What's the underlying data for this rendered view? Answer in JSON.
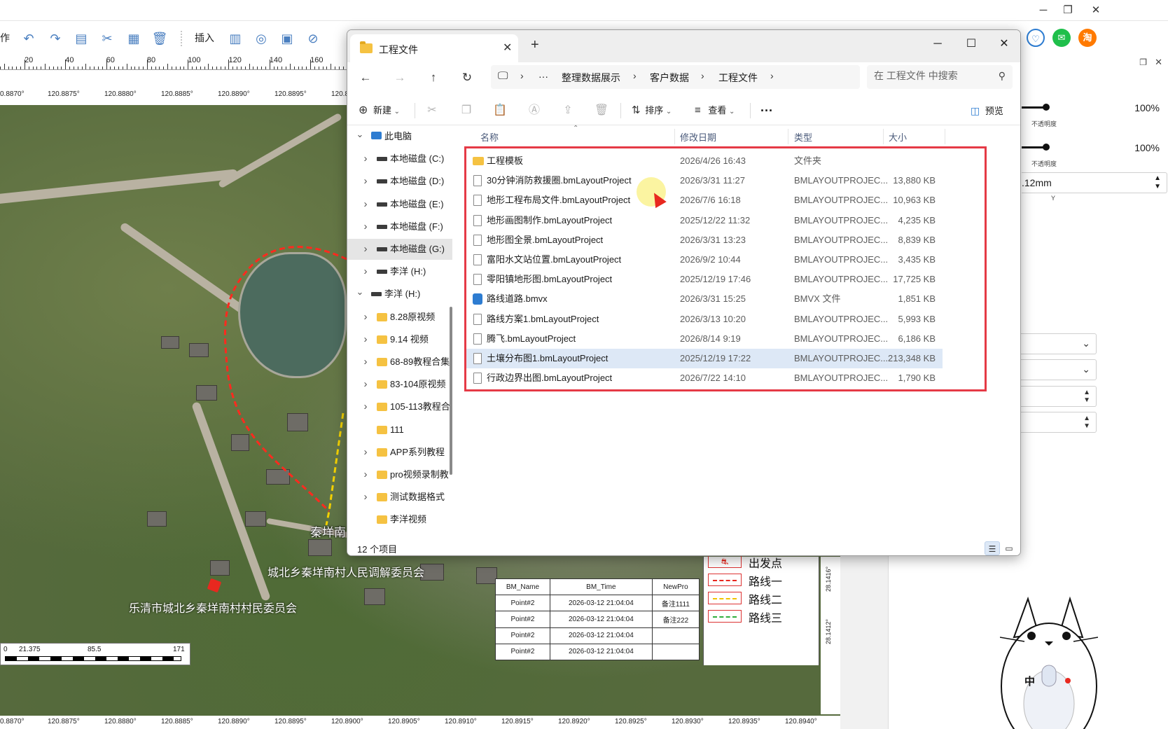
{
  "app": {
    "toolbar": {
      "insert_label": "插入",
      "left_cut_text": "作"
    },
    "ruler": [
      "20",
      "40",
      "60",
      "80",
      "100",
      "120",
      "140",
      "160"
    ],
    "coords_top": [
      "0.8870°",
      "120.8875°",
      "120.8880°",
      "120.8885°",
      "120.8890°",
      "120.8895°",
      "120.8"
    ],
    "coords_bottom": [
      "0.8870°",
      "120.8875°",
      "120.8880°",
      "120.8885°",
      "120.8890°",
      "120.8895°",
      "120.8900°",
      "120.8905°",
      "120.8910°",
      "120.8915°",
      "120.8920°",
      "120.8925°",
      "120.8930°",
      "120.8935°",
      "120.8940°"
    ],
    "map_labels": {
      "village_short": "秦垟南",
      "committee_mediation": "城北乡秦垟南村人民调解委员会",
      "committee_villagers": "乐清市城北乡秦垟南村村民委员会"
    },
    "scalebar": [
      "0",
      "21.375",
      "85.5",
      "171"
    ],
    "attr_table": {
      "headers": [
        "BM_Name",
        "BM_Time",
        "NewPro"
      ],
      "rows": [
        [
          "Point#2",
          "2026-03-12 21:04:04",
          "备注1111"
        ],
        [
          "Point#2",
          "2026-03-12 21:04:04",
          "备注222"
        ],
        [
          "Point#2",
          "2026-03-12 21:04:04",
          ""
        ],
        [
          "Point#2",
          "2026-03-12 21:04:04",
          ""
        ]
      ]
    },
    "legend": [
      {
        "label": "出发点",
        "color": "#e8281f"
      },
      {
        "label": "路线一",
        "color": "#e8281f"
      },
      {
        "label": "路线二",
        "color": "#f2c300"
      },
      {
        "label": "路线三",
        "color": "#2fae3c"
      }
    ],
    "lat_labels": [
      "28.1416°",
      "28.1412°"
    ],
    "right_panel": {
      "opacity1_value": "100%",
      "opacity1_label": "不透明度",
      "opacity2_value": "100%",
      "opacity2_label": "不透明度",
      "size_value": ".12mm",
      "size_axis": "Y"
    },
    "ext_icons": {
      "taobao": "淘"
    },
    "mascot": {
      "ime_label": "中"
    }
  },
  "explorer": {
    "tab_title": "工程文件",
    "breadcrumbs": [
      "整理数据展示",
      "客户数据",
      "工程文件"
    ],
    "search_placeholder": "在 工程文件 中搜索",
    "commands": {
      "new": "新建",
      "sort": "排序",
      "view": "查看",
      "preview": "预览"
    },
    "nav": [
      {
        "label": "此电脑",
        "type": "pc",
        "level": 0,
        "expanded": true
      },
      {
        "label": "本地磁盘 (C:)",
        "type": "drive",
        "level": 1
      },
      {
        "label": "本地磁盘 (D:)",
        "type": "drive",
        "level": 1
      },
      {
        "label": "本地磁盘 (E:)",
        "type": "drive",
        "level": 1
      },
      {
        "label": "本地磁盘 (F:)",
        "type": "drive",
        "level": 1
      },
      {
        "label": "本地磁盘 (G:)",
        "type": "drive",
        "level": 1,
        "selected": true
      },
      {
        "label": "李洋 (H:)",
        "type": "drive",
        "level": 1
      },
      {
        "label": "李洋 (H:)",
        "type": "drive",
        "level": 0,
        "expanded": true
      },
      {
        "label": "8.28原视频",
        "type": "folder",
        "level": 1
      },
      {
        "label": "9.14 视频",
        "type": "folder",
        "level": 1
      },
      {
        "label": "68-89教程合集",
        "type": "folder",
        "level": 1
      },
      {
        "label": "83-104原视频",
        "type": "folder",
        "level": 1
      },
      {
        "label": "105-113教程合",
        "type": "folder",
        "level": 1
      },
      {
        "label": "111",
        "type": "folder",
        "level": 1,
        "nochev": true
      },
      {
        "label": "APP系列教程",
        "type": "folder",
        "level": 1
      },
      {
        "label": "pro视频录制教",
        "type": "folder",
        "level": 1
      },
      {
        "label": "测试数据格式",
        "type": "folder",
        "level": 1
      },
      {
        "label": "李洋视频",
        "type": "folder",
        "level": 1,
        "nochev": true
      }
    ],
    "columns": {
      "name": "名称",
      "date": "修改日期",
      "type": "类型",
      "size": "大小"
    },
    "files": [
      {
        "name": "工程模板",
        "date": "2026/4/26 16:43",
        "type": "文件夹",
        "size": "",
        "icon": "folder"
      },
      {
        "name": "30分钟消防救援圈.bmLayoutProject",
        "date": "2026/3/31 11:27",
        "type": "BMLAYOUTPROJEC...",
        "size": "13,880 KB",
        "icon": "doc"
      },
      {
        "name": "地形工程布局文件.bmLayoutProject",
        "date": "2026/7/6 16:18",
        "type": "BMLAYOUTPROJEC...",
        "size": "10,963 KB",
        "icon": "doc"
      },
      {
        "name": "地形画图制作.bmLayoutProject",
        "date": "2025/12/22 11:32",
        "type": "BMLAYOUTPROJEC...",
        "size": "4,235 KB",
        "icon": "doc"
      },
      {
        "name": "地形图全景.bmLayoutProject",
        "date": "2026/3/31 13:23",
        "type": "BMLAYOUTPROJEC...",
        "size": "8,839 KB",
        "icon": "doc"
      },
      {
        "name": "富阳水文站位置.bmLayoutProject",
        "date": "2026/9/2 10:44",
        "type": "BMLAYOUTPROJEC...",
        "size": "3,435 KB",
        "icon": "doc"
      },
      {
        "name": "零阳镇地形图.bmLayoutProject",
        "date": "2025/12/19 17:46",
        "type": "BMLAYOUTPROJEC...",
        "size": "17,725 KB",
        "icon": "doc"
      },
      {
        "name": "路线道路.bmvx",
        "date": "2026/3/31 15:25",
        "type": "BMVX 文件",
        "size": "1,851 KB",
        "icon": "bmvx"
      },
      {
        "name": "路线方案1.bmLayoutProject",
        "date": "2026/3/13 10:20",
        "type": "BMLAYOUTPROJEC...",
        "size": "5,993 KB",
        "icon": "doc"
      },
      {
        "name": "腾飞.bmLayoutProject",
        "date": "2026/8/14 9:19",
        "type": "BMLAYOUTPROJEC...",
        "size": "6,186 KB",
        "icon": "doc"
      },
      {
        "name": "土壤分布图1.bmLayoutProject",
        "date": "2025/12/19 17:22",
        "type": "BMLAYOUTPROJEC...",
        "size": "213,348 KB",
        "icon": "doc",
        "selected": true
      },
      {
        "name": "行政边界出图.bmLayoutProject",
        "date": "2026/7/22 14:10",
        "type": "BMLAYOUTPROJEC...",
        "size": "1,790 KB",
        "icon": "doc"
      }
    ],
    "status": "12 个项目"
  }
}
